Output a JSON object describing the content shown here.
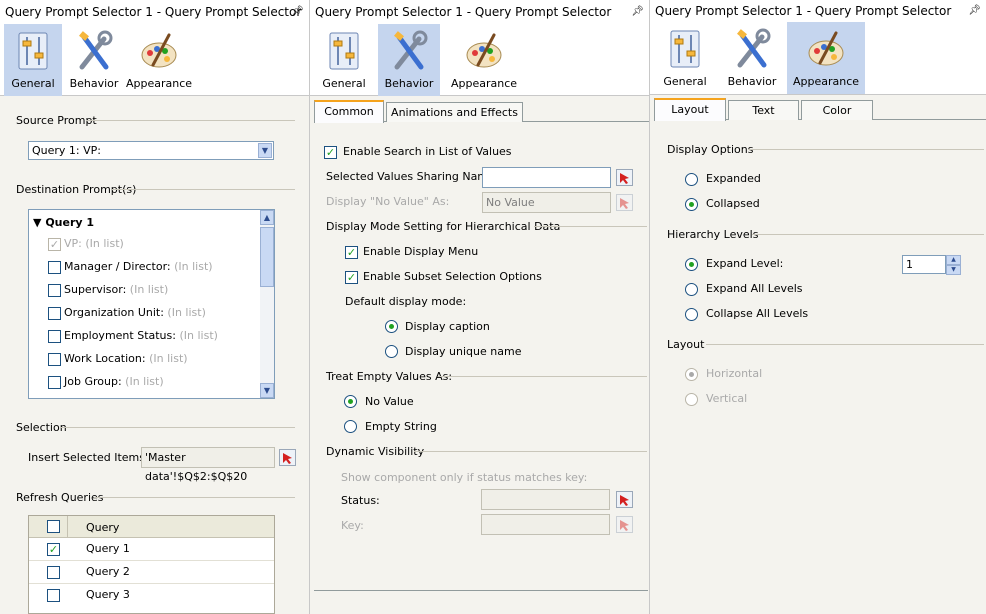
{
  "panel_title": "Query Prompt Selector 1 - Query Prompt Selector",
  "pin_icon": "pin-icon",
  "toolbar": {
    "general": "General",
    "behavior": "Behavior",
    "appearance": "Appearance"
  },
  "general": {
    "source_prompt_label": "Source Prompt",
    "source_prompt_value": "Query 1: VP:",
    "destination_label": "Destination Prompt(s)",
    "tree_group": "Query 1",
    "tree_items": [
      {
        "label": "VP:",
        "suffix": "(In list)",
        "checked": true,
        "disabled": true
      },
      {
        "label": "Manager / Director:",
        "suffix": "(In list)",
        "checked": false,
        "disabled": false
      },
      {
        "label": "Supervisor:",
        "suffix": "(In list)",
        "checked": false,
        "disabled": false
      },
      {
        "label": "Organization Unit:",
        "suffix": "(In list)",
        "checked": false,
        "disabled": false
      },
      {
        "label": "Employment Status:",
        "suffix": "(In list)",
        "checked": false,
        "disabled": false
      },
      {
        "label": "Work Location:",
        "suffix": "(In list)",
        "checked": false,
        "disabled": false
      },
      {
        "label": "Job Group:",
        "suffix": "(In list)",
        "checked": false,
        "disabled": false
      }
    ],
    "selection_label": "Selection",
    "insert_label": "Insert Selected Items:",
    "insert_value": "'Master data'!$Q$2:$Q$20",
    "refresh_label": "Refresh Queries",
    "query_header": "Query",
    "queries": [
      {
        "label": "Query 1",
        "checked": true
      },
      {
        "label": "Query 2",
        "checked": false
      },
      {
        "label": "Query 3",
        "checked": false
      }
    ]
  },
  "behavior": {
    "tabs": [
      "Common",
      "Animations and Effects"
    ],
    "enable_search": "Enable Search in List of Values",
    "sharing_name_label": "Selected Values Sharing Name:",
    "sharing_name_value": "",
    "no_value_label": "Display \"No Value\" As:",
    "no_value_value": "No Value",
    "hier_section": "Display Mode Setting for Hierarchical Data",
    "enable_display_menu": "Enable Display Menu",
    "enable_subset": "Enable Subset Selection Options",
    "default_mode_label": "Default display mode:",
    "display_caption": "Display caption",
    "display_unique": "Display unique name",
    "empty_section": "Treat Empty Values As:",
    "empty_no_value": "No Value",
    "empty_string": "Empty String",
    "dynamic_section": "Dynamic Visibility",
    "dynamic_hint": "Show component only if status matches key:",
    "status_label": "Status:",
    "key_label": "Key:"
  },
  "appearance": {
    "tabs": [
      "Layout",
      "Text",
      "Color"
    ],
    "display_options": "Display Options",
    "expanded": "Expanded",
    "collapsed": "Collapsed",
    "hierarchy_levels": "Hierarchy Levels",
    "expand_level": "Expand Level:",
    "expand_level_value": "1",
    "expand_all": "Expand All Levels",
    "collapse_all": "Collapse All Levels",
    "layout_section": "Layout",
    "horizontal": "Horizontal",
    "vertical": "Vertical"
  },
  "colors": {
    "selected_toolbar": "#c5d5ee",
    "check_green": "#21a121",
    "tab_accent": "#f5a31d",
    "panel_bg": "#f4f3ee"
  }
}
